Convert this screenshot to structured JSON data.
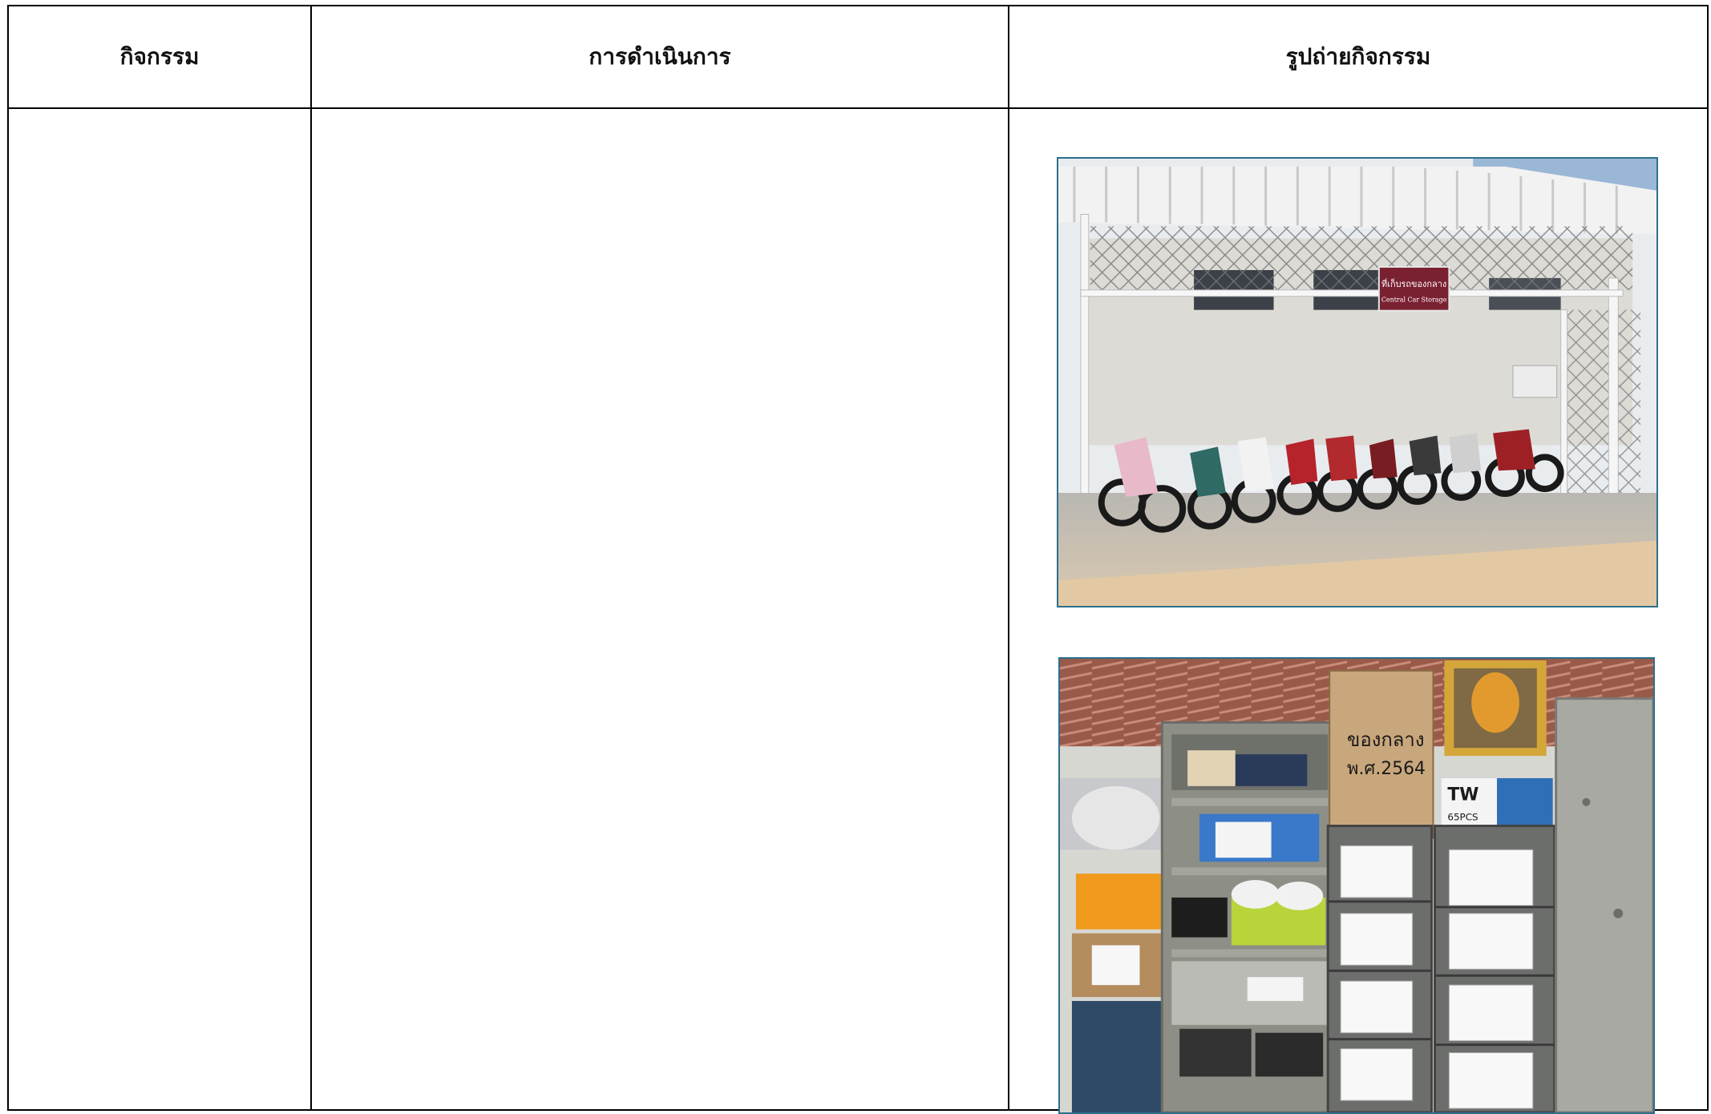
{
  "table": {
    "headers": {
      "activity": "กิจกรรม",
      "operation": "การดำเนินการ",
      "photos": "รูปถ่ายกิจกรรม"
    }
  },
  "photos": {
    "storage_sign": {
      "line1": "ที่เก็บรถของกลาง",
      "line2": "Central Car Storage"
    },
    "box_label": {
      "line1": "ของกลาง",
      "line2": "พ.ศ.2564"
    },
    "appliance_brand": "TW",
    "appliance_model": "65PCS"
  },
  "colors": {
    "border": "#000000",
    "photo_frame": "#2d6f8c",
    "sign_background": "#7a2131"
  }
}
